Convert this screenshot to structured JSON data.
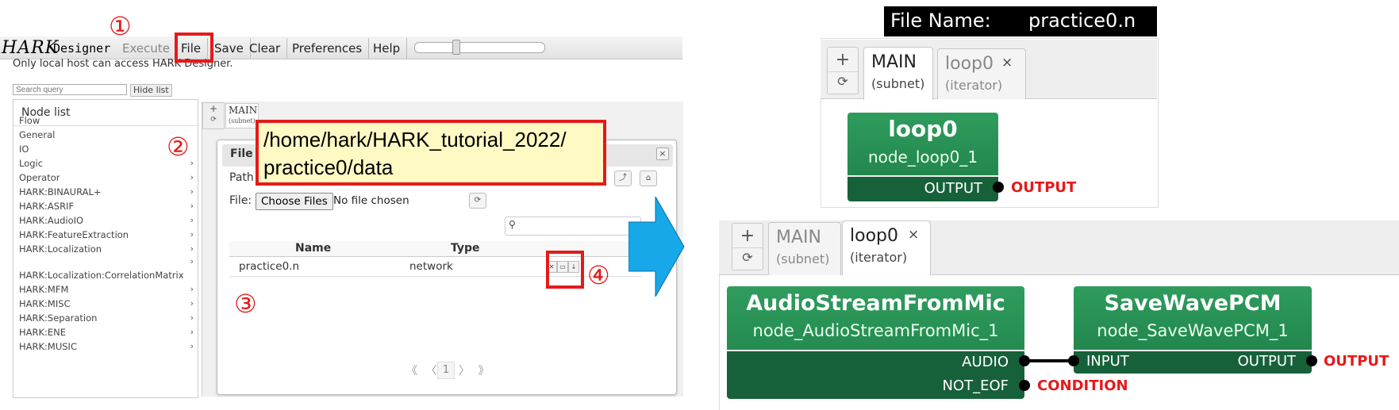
{
  "left_app": {
    "logo": "HARK",
    "logo_sub": "Designer",
    "menu": {
      "execute": "Execute",
      "file": "File",
      "save": "Save",
      "clear": "Clear",
      "preferences": "Preferences",
      "help": "Help"
    },
    "notice": "Only local host can access HARK Designer.",
    "search_placeholder": "Search query",
    "hide_list": "Hide list",
    "node_list_title": "Node list",
    "node_items": [
      {
        "label": "Flow",
        "chev": ""
      },
      {
        "label": "General",
        "chev": ""
      },
      {
        "label": "IO",
        "chev": ""
      },
      {
        "label": "Logic",
        "chev": "›"
      },
      {
        "label": "Operator",
        "chev": "›"
      },
      {
        "label": "HARK:BINAURAL+",
        "chev": "›"
      },
      {
        "label": "HARK:ASRIF",
        "chev": "›"
      },
      {
        "label": "HARK:AudioIO",
        "chev": "›"
      },
      {
        "label": "HARK:FeatureExtraction",
        "chev": "›"
      },
      {
        "label": "HARK:Localization",
        "chev": "›"
      },
      {
        "label": "",
        "chev": "›"
      },
      {
        "label": "HARK:Localization:CorrelationMatrix",
        "chev": ""
      },
      {
        "label": "HARK:MFM",
        "chev": "›"
      },
      {
        "label": "HARK:MISC",
        "chev": "›"
      },
      {
        "label": "HARK:Separation",
        "chev": "›"
      },
      {
        "label": "HARK:ENE",
        "chev": "›"
      },
      {
        "label": "HARK:MUSIC",
        "chev": "›"
      }
    ],
    "mini_tab": {
      "title": "MAIN",
      "sub": "(subnet)"
    },
    "dialog": {
      "title": "File",
      "path_label": "Path",
      "file_label": "File:",
      "choose_files": "Choose Files",
      "no_file": "No file chosen",
      "columns": {
        "name": "Name",
        "type": "Type"
      },
      "rows": [
        {
          "name": "practice0.n",
          "type": "network"
        }
      ],
      "pager_left": "《 〈",
      "pager_num": "1",
      "pager_right": "〉 》"
    },
    "path_tooltip": {
      "line1": "/home/hark/HARK_tutorial_2022/",
      "line2": "practice0/data"
    },
    "steps": [
      "①",
      "②",
      "③",
      "④"
    ]
  },
  "right_top": {
    "file_name_label": "File Name:",
    "file_name_value": "practice0.n",
    "tabs": [
      {
        "title": "MAIN",
        "sub": "(subnet)"
      },
      {
        "title": "loop0",
        "sub": "(iterator)",
        "close": "×"
      }
    ],
    "node": {
      "title": "loop0",
      "sub": "node_loop0_1",
      "port_out": "OUTPUT",
      "out_tag": "OUTPUT"
    }
  },
  "right_bottom": {
    "tabs": [
      {
        "title": "MAIN",
        "sub": "(subnet)"
      },
      {
        "title": "loop0",
        "sub": "(iterator)",
        "close": "×"
      }
    ],
    "node_asfm": {
      "title": "AudioStreamFromMic",
      "sub": "node_AudioStreamFromMic_1",
      "port_audio": "AUDIO",
      "port_eof": "NOT_EOF",
      "tag_condition": "CONDITION"
    },
    "node_swp": {
      "title": "SaveWavePCM",
      "sub": "node_SaveWavePCM_1",
      "port_in": "INPUT",
      "port_out": "OUTPUT",
      "out_tag": "OUTPUT"
    }
  },
  "icons": {
    "plus": "+",
    "reload": "⟳",
    "close": "×",
    "search": "🔍"
  },
  "colors": {
    "node_green": "#2f9c5d",
    "highlight_red": "#e41a1a",
    "tooltip_yellow": "#fff9c4",
    "arrow_blue": "#16a8e8"
  }
}
